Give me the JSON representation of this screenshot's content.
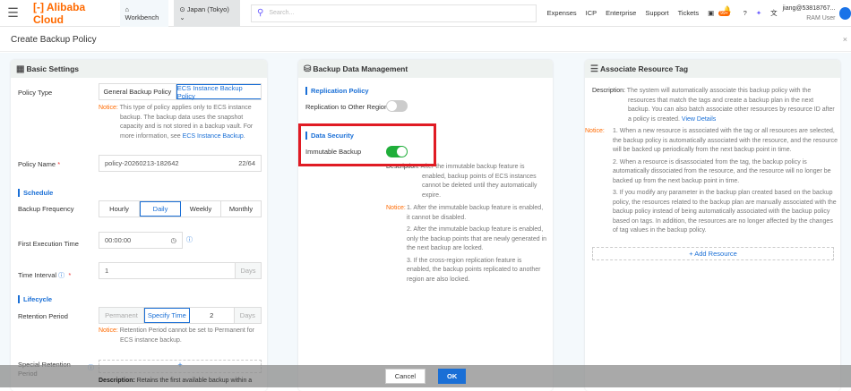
{
  "topbar": {
    "logo": "Alibaba Cloud",
    "workbench": "Workbench",
    "region": "Japan (Tokyo)",
    "search_placeholder": "Search...",
    "links": [
      "Expenses",
      "ICP",
      "Enterprise",
      "Support",
      "Tickets"
    ],
    "badge": "99+",
    "user": "jiang@53818767...",
    "user_role": "RAM User"
  },
  "page": {
    "title": "Create Backup Policy"
  },
  "basic": {
    "title": "Basic Settings",
    "policy_type_label": "Policy Type",
    "policy_types": [
      "General Backup Policy",
      "ECS Instance Backup Policy"
    ],
    "notice_label": "Notice:",
    "notice_text": "This type of policy applies only to ECS instance backup. The backup data uses the snapshot capacity and is not stored in a backup vault. For more information, see ",
    "notice_link": "ECS Instance Backup",
    "policy_name_label": "Policy Name",
    "policy_name_value": "policy-20260213-182642",
    "policy_name_count": "22/64",
    "schedule": "Schedule",
    "freq_label": "Backup Frequency",
    "freq_options": [
      "Hourly",
      "Daily",
      "Weekly",
      "Monthly"
    ],
    "first_exec_label": "First Execution Time",
    "first_exec_value": "00:00:00",
    "interval_label": "Time Interval",
    "interval_value": "1",
    "interval_unit": "Days",
    "lifecycle": "Lifecycle",
    "retention_label": "Retention Period",
    "retention_options": [
      "Permanent",
      "Specify Time"
    ],
    "retention_value": "2",
    "retention_unit": "Days",
    "retention_notice": "Retention Period cannot be set to Permanent for ECS instance backup.",
    "special_label": "Special Retention Period",
    "special_add": "+",
    "special_desc_label": "Description:",
    "special_desc": "Retains the first available backup within a"
  },
  "bdm": {
    "title": "Backup Data Management",
    "replication": "Replication Policy",
    "replication_label": "Replication to Other Region",
    "replication_on": false,
    "security": "Data Security",
    "immutable_label": "Immutable Backup",
    "immutable_on": true,
    "desc_label": "Description:",
    "desc": "After the immutable backup feature is enabled, backup points of ECS instances cannot be deleted until they automatically expire.",
    "notice_label": "Notice:",
    "notices": [
      "1. After the immutable backup feature is enabled, it cannot be disabled.",
      "2. After the immutable backup feature is enabled, only the backup points that are newly generated in the next backup are locked.",
      "3. If the cross-region replication feature is enabled, the backup points replicated to another region are also locked."
    ]
  },
  "tag": {
    "title": "Associate Resource Tag",
    "desc_label": "Description:",
    "desc": "The system will automatically associate this backup policy with the resources that match the tags and create a backup plan in the next backup. You can also batch associate other resources by resource ID after a policy is created. ",
    "desc_link": "View Details",
    "notice_label": "Notice:",
    "notices": [
      "1. When a new resource is associated with the tag or all resources are selected, the backup policy is automatically associated with the resource, and the resource will be backed up periodically from the next backup point in time.",
      "2. When a resource is disassociated from the tag, the backup policy is automatically dissociated from the resource, and the resource will no longer be backed up from the next backup point in time.",
      "3. If you modify any parameter in the backup plan created based on the backup policy, the resources related to the backup plan are manually associated with the backup policy instead of being automatically associated with the backup policy based on tags. In addition, the resources are no longer affected by the changes of tag values in the backup policy."
    ],
    "add": "+ Add Resource"
  },
  "footer": {
    "cancel": "Cancel",
    "ok": "OK"
  }
}
